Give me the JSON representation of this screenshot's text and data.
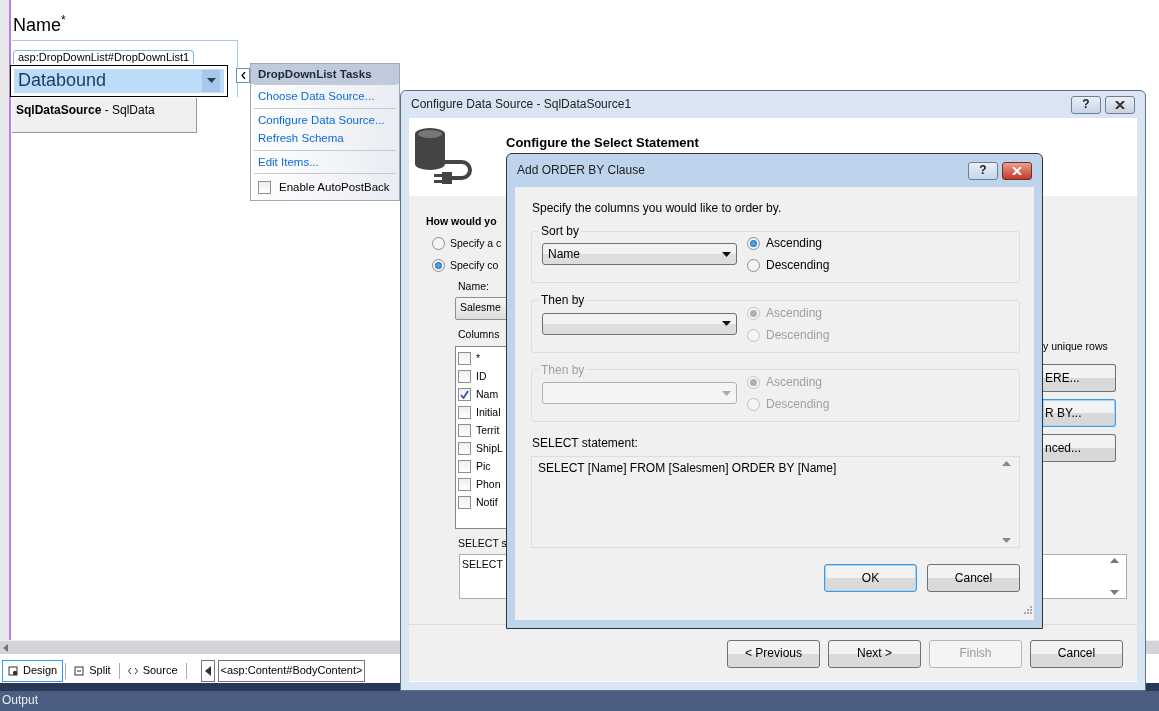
{
  "designer": {
    "field_label": "Name",
    "required_mark": "*",
    "control_tag": "asp:DropDownList#DropDownList1",
    "dropdown_value": "Databound",
    "datasource": "**SqlDataSource** - SqlData"
  },
  "tasks_panel": {
    "title": "DropDownList Tasks",
    "groups": [
      {
        "items": [
          {
            "kind": "link",
            "label": "Choose Data Source..."
          }
        ]
      },
      {
        "items": [
          {
            "kind": "link",
            "label": "Configure Data Source..."
          },
          {
            "kind": "link",
            "label": "Refresh Schema"
          }
        ]
      },
      {
        "items": [
          {
            "kind": "link",
            "label": "Edit Items..."
          }
        ]
      },
      {
        "items": [
          {
            "kind": "checkbox",
            "label": "Enable AutoPostBack",
            "checked": false
          }
        ]
      }
    ]
  },
  "view_tabs": [
    {
      "label": "Design",
      "selected": true
    },
    {
      "label": "Split",
      "selected": false
    },
    {
      "label": "Source",
      "selected": false
    }
  ],
  "breadcrumb": "<asp:Content#BodyContent>",
  "output_panel": {
    "title": "Output"
  },
  "wizard": {
    "title": "Configure Data Source - SqlDataSource1",
    "help_button": "?",
    "heading": "Configure the Select Statement",
    "question": "How would yo",
    "options": [
      {
        "label": "Specify a c",
        "selected": false
      },
      {
        "label": "Specify co",
        "selected": true
      }
    ],
    "name_label": "Name:",
    "table_value": "Salesme",
    "columns_label": "Columns",
    "columns": [
      {
        "label": "*",
        "checked": false
      },
      {
        "label": "ID",
        "checked": false
      },
      {
        "label": "Nam",
        "checked": true
      },
      {
        "label": "Initial",
        "checked": false
      },
      {
        "label": "Territ",
        "checked": false
      },
      {
        "label": "ShipL",
        "checked": false
      },
      {
        "label": "Pic",
        "checked": false
      },
      {
        "label": "Phon",
        "checked": false
      },
      {
        "label": "Notif",
        "checked": false
      }
    ],
    "select_label": "SELECT s",
    "select_text": "SELECT",
    "unique_rows_label": "y unique rows",
    "side_buttons": [
      {
        "label": "ERE...",
        "focused": false
      },
      {
        "label": "R BY...",
        "focused": true
      },
      {
        "label": "nced...",
        "focused": false
      }
    ],
    "footer_buttons": [
      {
        "label": "< Previous",
        "disabled": false
      },
      {
        "label": "Next >",
        "disabled": false
      },
      {
        "label": "Finish",
        "disabled": true
      },
      {
        "label": "Cancel",
        "disabled": false
      }
    ]
  },
  "order_by_dialog": {
    "title": "Add ORDER BY Clause",
    "help_button": "?",
    "instruction": "Specify the columns you would like to order by.",
    "groups": [
      {
        "label": "Sort by",
        "value": "Name",
        "disabled": false,
        "options": [
          {
            "label": "Ascending",
            "selected": true,
            "disabled": false
          },
          {
            "label": "Descending",
            "selected": false,
            "disabled": false
          }
        ]
      },
      {
        "label": "Then by",
        "disabled": false,
        "options": [
          {
            "label": "Ascending",
            "selected": true,
            "disabled": true
          },
          {
            "label": "Descending",
            "selected": false,
            "disabled": true
          }
        ]
      },
      {
        "label": "Then by",
        "disabled": true,
        "options": [
          {
            "label": "Ascending",
            "selected": true,
            "disabled": true
          },
          {
            "label": "Descending",
            "selected": false,
            "disabled": true
          }
        ]
      }
    ],
    "select_label": "SELECT statement:",
    "select_text": "SELECT [Name] FROM [Salesmen] ORDER BY [Name]",
    "buttons": [
      {
        "label": "OK",
        "default": true
      },
      {
        "label": "Cancel",
        "default": false
      }
    ]
  }
}
